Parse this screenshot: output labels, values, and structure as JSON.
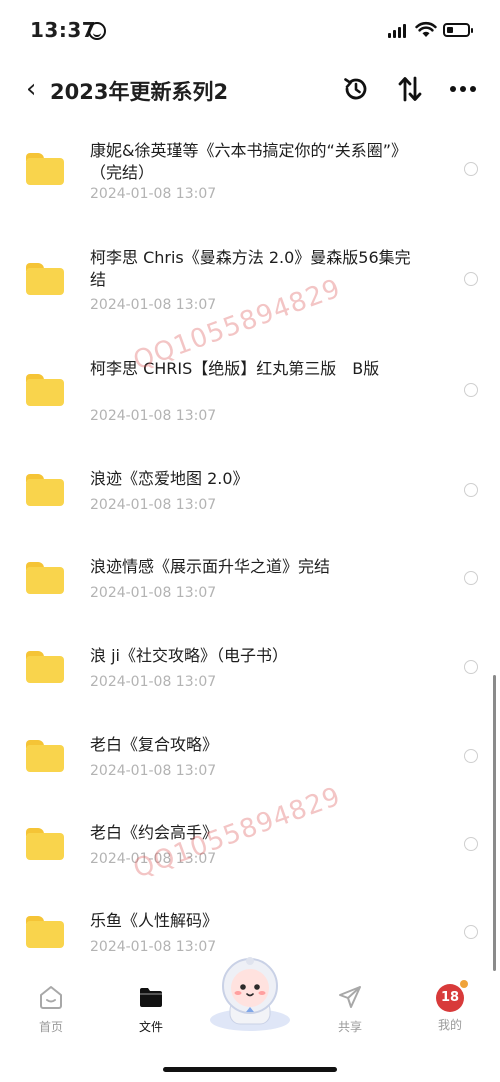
{
  "status": {
    "time": "13:37"
  },
  "nav": {
    "back_glyph": "‹",
    "title": "2023年更新系列2"
  },
  "items": [
    {
      "name": "康妮&徐英瑾等《六本书搞定你的“关系圈”》（完结）",
      "date": "2024-01-08 13:07"
    },
    {
      "name": "柯李思 Chris《曼森方法 2.0》曼森版56集完结",
      "date": "2024-01-08 13:07"
    },
    {
      "name": "柯李思 CHRIS【绝版】红丸第三版　B版",
      "date": "2024-01-08 13:07"
    },
    {
      "name": "浪迹《恋爱地图 2.0》",
      "date": "2024-01-08 13:07"
    },
    {
      "name": "浪迹情感《展示面升华之道》完结",
      "date": "2024-01-08 13:07"
    },
    {
      "name": "浪 ji《社交攻略》（电子书）",
      "date": "2024-01-08 13:07"
    },
    {
      "name": "老白《复合攻略》",
      "date": "2024-01-08 13:07"
    },
    {
      "name": "老白《约会高手》",
      "date": "2024-01-08 13:07"
    },
    {
      "name": "乐鱼《人性解码》",
      "date": "2024-01-08 13:07"
    }
  ],
  "watermark": "QQ1055894829",
  "tabbar": {
    "home": "首页",
    "files": "文件",
    "share": "共享",
    "mine": "我的",
    "avatar_text": "18"
  },
  "colors": {
    "folder": "#f9d44c",
    "date": "#b3b3b3",
    "watermark": "#dc5a5a"
  }
}
